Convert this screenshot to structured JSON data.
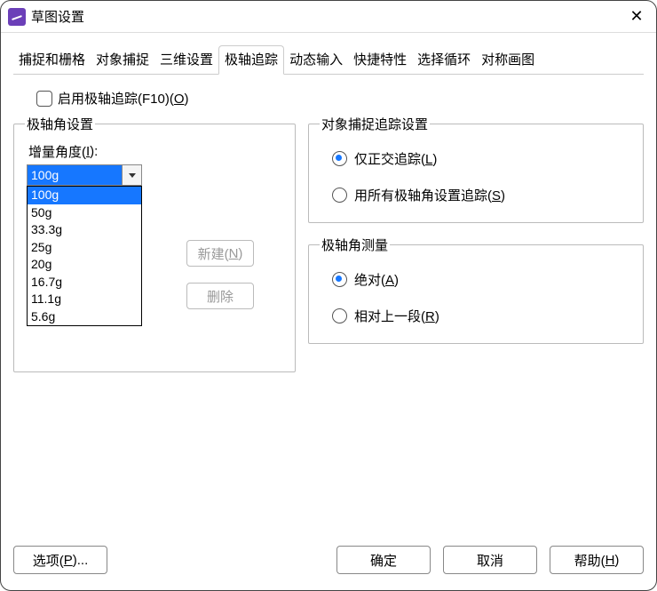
{
  "window": {
    "title": "草图设置"
  },
  "tabs": {
    "items": [
      {
        "label": "捕捉和栅格"
      },
      {
        "label": "对象捕捉"
      },
      {
        "label": "三维设置"
      },
      {
        "label": "极轴追踪"
      },
      {
        "label": "动态输入"
      },
      {
        "label": "快捷特性"
      },
      {
        "label": "选择循环"
      },
      {
        "label": "对称画图"
      }
    ],
    "active_index": 3
  },
  "enable_polar": {
    "label_main": "启用极轴追踪(F10)(",
    "label_key": "O",
    "label_end": ")"
  },
  "polar_angle": {
    "legend": "极轴角设置",
    "increment_label_main": "增量角度(",
    "increment_key": "I",
    "increment_label_end": "):",
    "value": "100g",
    "options": [
      "100g",
      "50g",
      "33.3g",
      "25g",
      "20g",
      "16.7g",
      "11.1g",
      "5.6g"
    ],
    "new_label_main": "新建(",
    "new_key": "N",
    "new_label_end": ")",
    "delete_label": "删除"
  },
  "osnap_track": {
    "legend": "对象捕捉追踪设置",
    "ortho_main": "仅正交追踪(",
    "ortho_key": "L",
    "ortho_end": ")",
    "all_main": "用所有极轴角设置追踪(",
    "all_key": "S",
    "all_end": ")"
  },
  "measure": {
    "legend": "极轴角测量",
    "abs_main": "绝对(",
    "abs_key": "A",
    "abs_end": ")",
    "rel_main": "相对上一段(",
    "rel_key": "R",
    "rel_end": ")"
  },
  "footer": {
    "options_main": "选项(",
    "options_key": "P",
    "options_end": ")...",
    "ok": "确定",
    "cancel": "取消",
    "help_main": "帮助(",
    "help_key": "H",
    "help_end": ")"
  }
}
